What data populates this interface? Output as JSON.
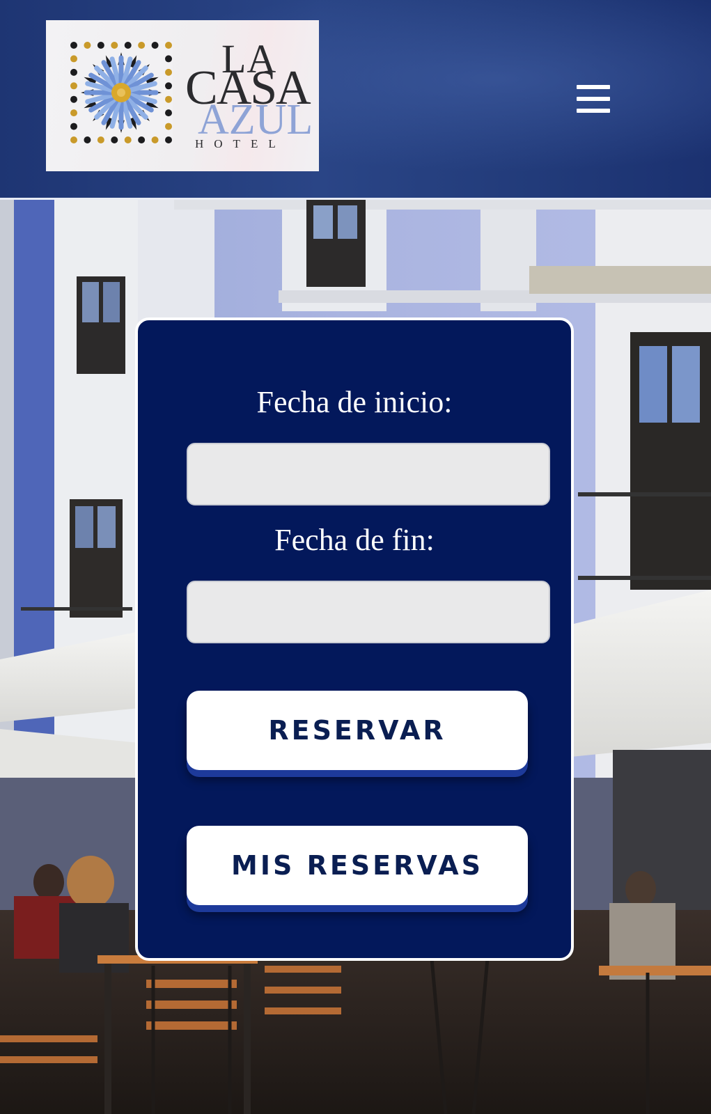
{
  "header": {
    "logo": {
      "line1": "LA",
      "line2": "CASA",
      "line3": "AZUL",
      "line4": "HOTEL"
    },
    "menu_icon": "hamburger-menu-icon"
  },
  "booking_form": {
    "start_date_label": "Fecha de inicio:",
    "start_date_value": "",
    "end_date_label": "Fecha de fin:",
    "end_date_value": "",
    "reserve_button": "RESERVAR",
    "my_bookings_button": "MIS RESERVAS"
  },
  "colors": {
    "header_blue": "#223b7a",
    "card_navy": "#03185b",
    "button_text": "#0a1e52",
    "button_shadow": "#1d3a9a",
    "input_bg": "#e9e9ea",
    "logo_azul": "#8ea3d6"
  }
}
